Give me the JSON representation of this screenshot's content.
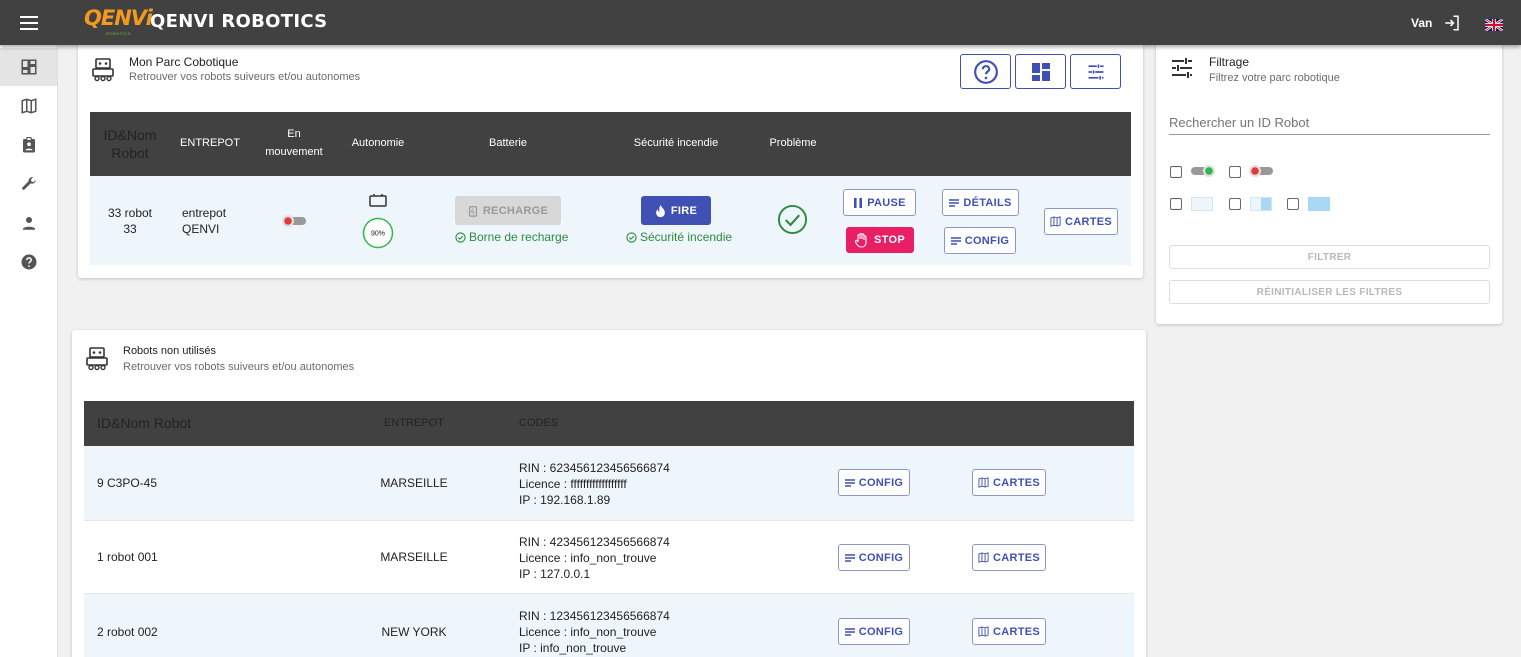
{
  "header": {
    "logo_text": "QENVi",
    "logo_sub": "ROBOTICS",
    "brand": "QENVI ROBOTICS",
    "user": "Van"
  },
  "sidenav": {
    "items": [
      "dashboard-icon",
      "map-icon",
      "assignment-icon",
      "wrench-icon",
      "person-icon",
      "help-icon"
    ]
  },
  "fleet": {
    "title": "Mon Parc Cobotique",
    "subtitle": "Retrouver vos robots suiveurs et/ou autonomes",
    "columns": {
      "id": "ID&Nom Robot",
      "entrepot": "ENTREPOT",
      "mouvement": "En mouvement",
      "autonomie": "Autonomie",
      "batterie": "Batterie",
      "securite": "Sécurité incendie",
      "probleme": "Problème"
    },
    "row": {
      "id_line1": "33 robot",
      "id_line2": "33",
      "entrepot_line1": "entrepot",
      "entrepot_line2": "QENVI",
      "autonomie": "90%",
      "autonomie_value": 0.9,
      "recharge_label": "RECHARGE",
      "recharge_status": "Borne de recharge",
      "fire_label": "FIRE",
      "fire_status": "Sécurité incendie",
      "pause_label": "PAUSE",
      "stop_label": "STOP",
      "details_label": "DÉTAILS",
      "config_label": "CONFIG",
      "cartes_label": "CARTES"
    }
  },
  "unused": {
    "title": "Robots non utilisés",
    "subtitle": "Retrouver vos robots suiveurs et/ou autonomes",
    "columns": {
      "id": "ID&Nom Robot",
      "entrepot": "ENTREPOT",
      "codes": "CODES"
    },
    "config_label": "CONFIG",
    "cartes_label": "CARTES",
    "rows": [
      {
        "name": "9 C3PO-45",
        "entrepot": "MARSEILLE",
        "rin": "RIN : 623456123456566874",
        "licence": "Licence : ffffffffffffffffff",
        "ip": "IP : 192.168.1.89"
      },
      {
        "name": "1 robot 001",
        "entrepot": "MARSEILLE",
        "rin": "RIN : 423456123456566874",
        "licence": "Licence : info_non_trouve",
        "ip": "IP : 127.0.0.1"
      },
      {
        "name": "2 robot 002",
        "entrepot": "NEW YORK",
        "rin": "RIN : 123456123456566874",
        "licence": "Licence : info_non_trouve",
        "ip": "IP : info_non_trouve"
      }
    ]
  },
  "filter": {
    "title": "Filtrage",
    "subtitle": "Filtrez votre parc robotique",
    "search_placeholder": "Rechercher un ID Robot",
    "filter_button": "FILTRER",
    "reset_button": "RÉINITIALISER LES FILTRES"
  },
  "colors": {
    "accent": "#3f51b5",
    "danger": "#e91e63",
    "success": "#2e8b3e",
    "header": "#414141",
    "row_highlight": "#eef6fc"
  }
}
